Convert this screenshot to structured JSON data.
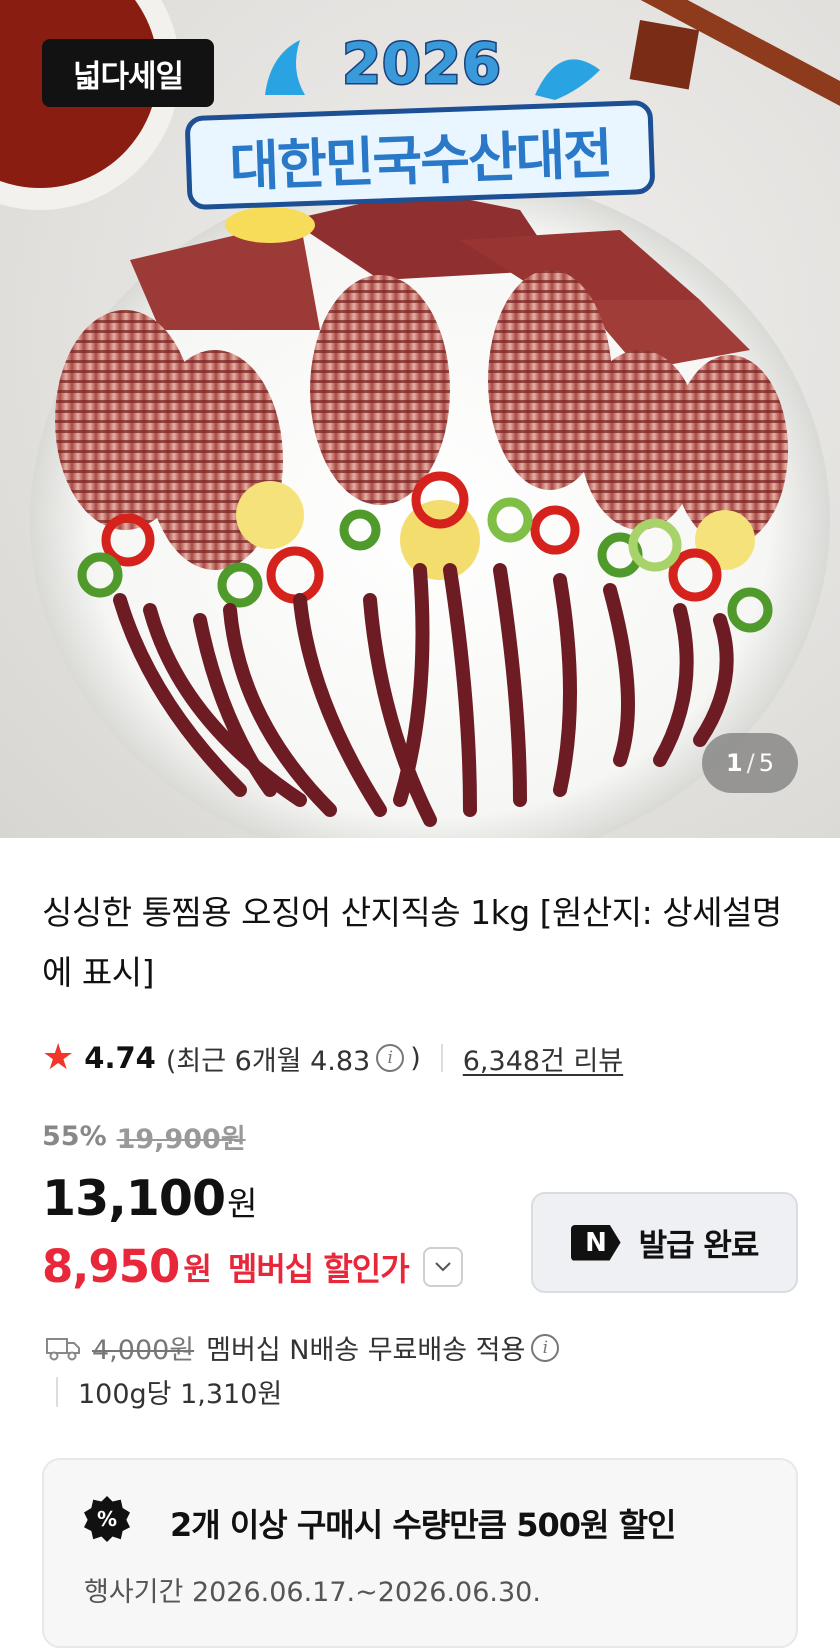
{
  "hero": {
    "badge": "넓다세일",
    "event_year": "2026",
    "event_title": "대한민국수산대전",
    "counter_current": "1",
    "counter_total": "5"
  },
  "product": {
    "title": "싱싱한 통찜용 오징어 산지직송 1kg [원산지: 상세설명에 표시]"
  },
  "rating": {
    "score": "4.74",
    "recent_open": "(최근 6개월 4.83",
    "recent_close": ")",
    "reviews": "6,348건 리뷰"
  },
  "pricing": {
    "discount_rate": "55%",
    "original_price": "19,900원",
    "price": "13,100",
    "price_unit": "원",
    "member_price": "8,950",
    "member_unit": "원",
    "member_label": "멤버십 할인가"
  },
  "coupon": {
    "logo": "N",
    "label": "발급 완료"
  },
  "delivery": {
    "old_fee": "4,000원",
    "text": "멤버십 N배송 무료배송 적용",
    "unit_price": "100g당 1,310원"
  },
  "promo": {
    "icon": "%",
    "title": "2개 이상 구매시 수량만큼 500원 할인",
    "period": "행사기간 2026.06.17.~2026.06.30."
  },
  "colors": {
    "accent_red": "#e8283a",
    "star": "#f2362a"
  }
}
